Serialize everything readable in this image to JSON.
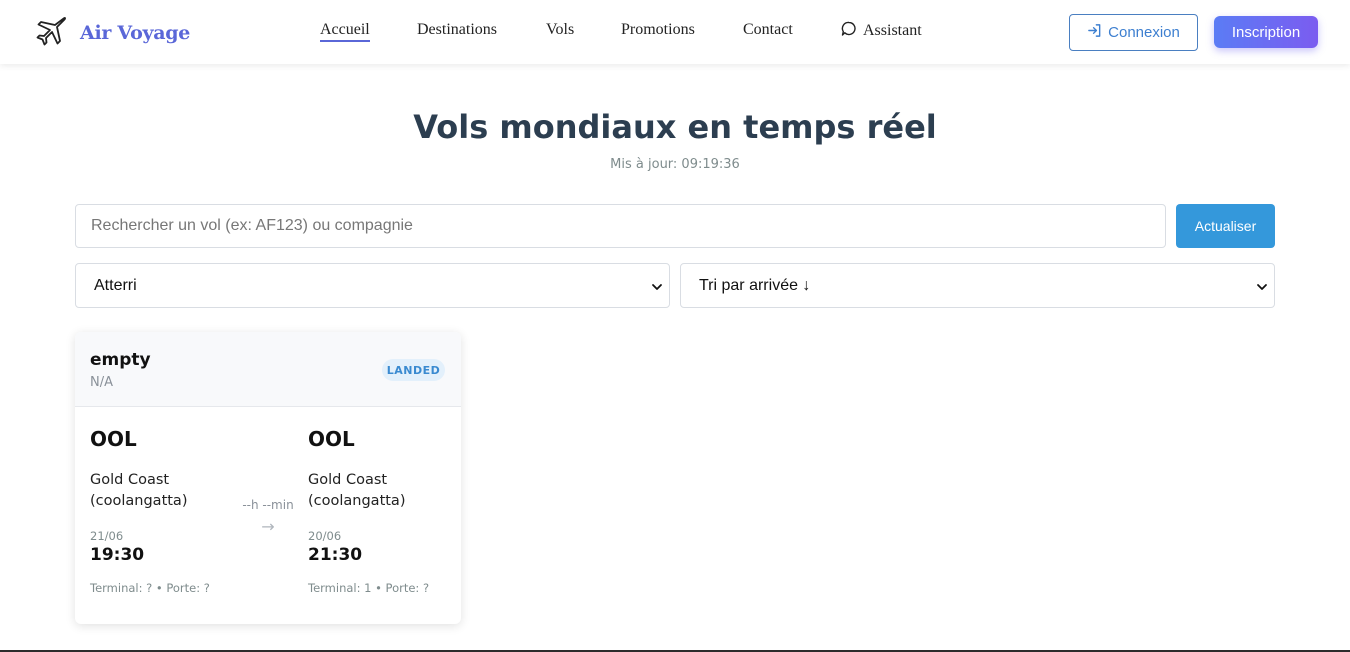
{
  "brand": {
    "name": "Air Voyage",
    "logo_icon": "airplane-icon"
  },
  "nav": {
    "items": [
      {
        "label": "Accueil",
        "active": true
      },
      {
        "label": "Destinations",
        "active": false
      },
      {
        "label": "Vols",
        "active": false
      },
      {
        "label": "Promotions",
        "active": false
      },
      {
        "label": "Contact",
        "active": false
      },
      {
        "label": "Assistant",
        "active": false,
        "icon": "chat-bubble-icon"
      }
    ],
    "login_label": "Connexion",
    "login_icon": "sign-in-icon",
    "signup_label": "Inscription"
  },
  "header": {
    "title": "Vols mondiaux en temps réel",
    "updated": "Mis à jour: 09:19:36"
  },
  "search": {
    "placeholder": "Rechercher un vol (ex: AF123) ou compagnie",
    "value": "",
    "refresh_label": "Actualiser"
  },
  "filters": {
    "status_selected": "Atterri",
    "sort_selected": "Tri par arrivée ↓"
  },
  "flights": [
    {
      "airline": "empty",
      "flight_number": "N/A",
      "status": "LANDED",
      "departure": {
        "code": "OOL",
        "city": "Gold Coast (coolangatta)",
        "date": "21/06",
        "time": "19:30",
        "terminal_gate": "Terminal: ? • Porte: ?"
      },
      "duration": "--h --min",
      "arrow": "→",
      "arrival": {
        "code": "OOL",
        "city": "Gold Coast (coolangatta)",
        "date": "20/06",
        "time": "21:30",
        "terminal_gate": "Terminal: 1 • Porte: ?"
      }
    }
  ],
  "colors": {
    "brand": "#5a67d8",
    "primary": "#3498db",
    "signup_gradient_start": "#5b7cf5",
    "signup_gradient_end": "#7b5cf0",
    "status_landed_bg": "#e3f0fb",
    "status_landed_text": "#3a8ad0"
  }
}
